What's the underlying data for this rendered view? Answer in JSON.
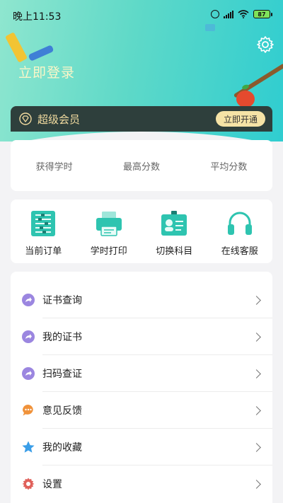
{
  "status": {
    "time": "晚上11:53",
    "battery": "87"
  },
  "header": {
    "login_label": "立即登录",
    "settings_icon": "gear-icon"
  },
  "vip": {
    "label": "超级会员",
    "button": "立即开通",
    "icon": "diamond-icon"
  },
  "stats": [
    {
      "label": "获得学时"
    },
    {
      "label": "最高分数"
    },
    {
      "label": "平均分数"
    }
  ],
  "shortcuts": [
    {
      "label": "当前订单",
      "icon": "abacus-icon"
    },
    {
      "label": "学时打印",
      "icon": "printer-icon"
    },
    {
      "label": "切换科目",
      "icon": "id-card-icon"
    },
    {
      "label": "在线客服",
      "icon": "headset-icon"
    }
  ],
  "menu": [
    {
      "label": "证书查询",
      "icon": "share-icon",
      "color": "#9b86e0"
    },
    {
      "label": "我的证书",
      "icon": "share-icon",
      "color": "#9b86e0"
    },
    {
      "label": "扫码查证",
      "icon": "share-icon",
      "color": "#9b86e0"
    },
    {
      "label": "意见反馈",
      "icon": "chat-icon",
      "color": "#f0923a"
    },
    {
      "label": "我的收藏",
      "icon": "star-icon",
      "color": "#3a9ee8"
    },
    {
      "label": "设置",
      "icon": "gear-icon",
      "color": "#e0605a"
    }
  ],
  "colors": {
    "accent": "#2ec4b0",
    "vip_bg": "#2e3f3c",
    "vip_text": "#f3dca0"
  }
}
